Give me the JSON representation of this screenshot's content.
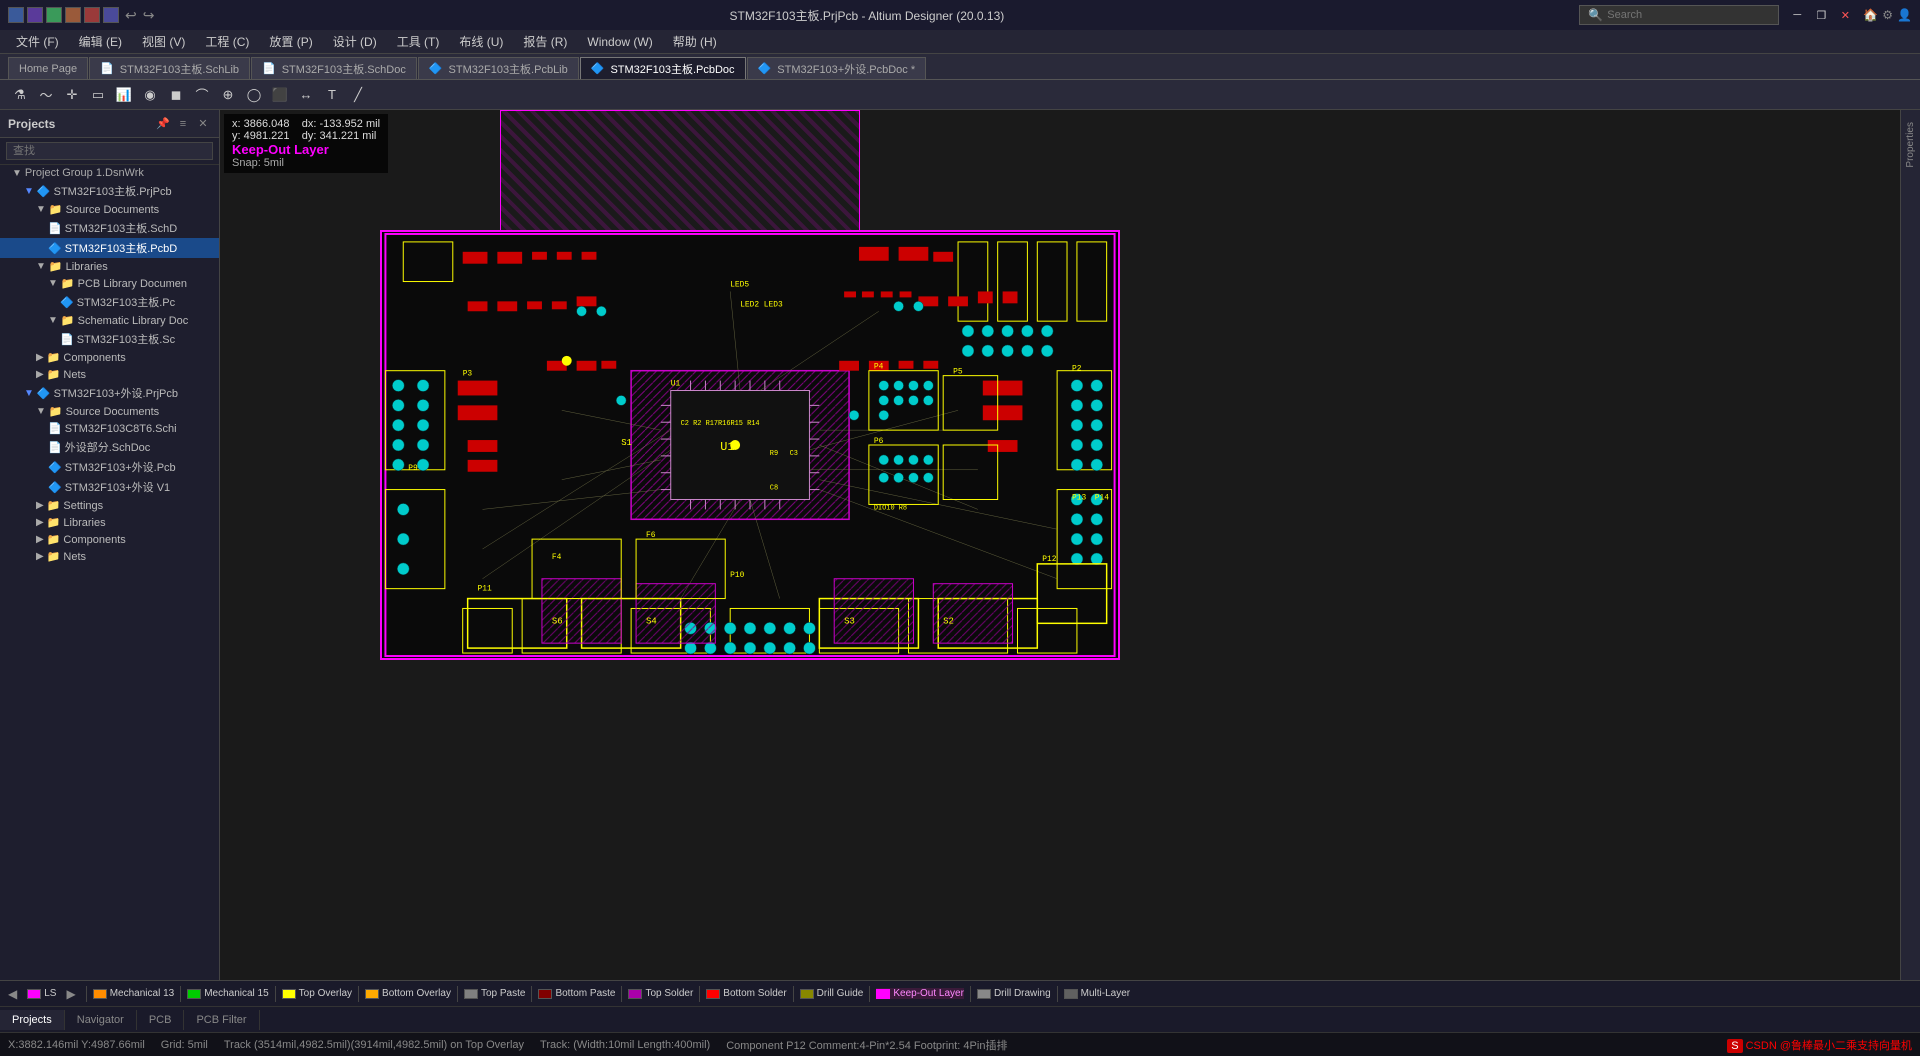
{
  "titlebar": {
    "title": "STM32F103主板.PrjPcb - Altium Designer (20.0.13)",
    "search_placeholder": "Search",
    "minimize_label": "─",
    "restore_label": "❐",
    "close_label": "✕"
  },
  "menubar": {
    "items": [
      {
        "label": "文件 (F)"
      },
      {
        "label": "编辑 (E)"
      },
      {
        "label": "视图 (V)"
      },
      {
        "label": "工程 (C)"
      },
      {
        "label": "放置 (P)"
      },
      {
        "label": "设计 (D)"
      },
      {
        "label": "工具 (T)"
      },
      {
        "label": "布线 (U)"
      },
      {
        "label": "报告 (R)"
      },
      {
        "label": "Window (W)"
      },
      {
        "label": "帮助 (H)"
      }
    ]
  },
  "tabbar": {
    "tabs": [
      {
        "label": "Home Page",
        "active": false,
        "modified": false
      },
      {
        "label": "STM32F103主板.SchLib",
        "active": false,
        "modified": false
      },
      {
        "label": "STM32F103主板.SchDoc",
        "active": false,
        "modified": false
      },
      {
        "label": "STM32F103主板.PcbLib",
        "active": false,
        "modified": false
      },
      {
        "label": "STM32F103主板.PcbDoc",
        "active": true,
        "modified": false
      },
      {
        "label": "STM32F103+外设.PcbDoc",
        "active": false,
        "modified": true
      }
    ]
  },
  "coordinates": {
    "x_label": "x:",
    "x_value": "3866.048",
    "dx_label": "dx:",
    "dx_value": "-133.952 mil",
    "y_label": "y:",
    "y_value": "4981.221",
    "dy_label": "dy:",
    "dy_value": "341.221 mil",
    "layer": "Keep-Out Layer",
    "snap": "Snap: 5mil"
  },
  "sidebar": {
    "title": "Projects",
    "search_placeholder": "查找",
    "tree": {
      "group1": {
        "label": "Project Group 1.DsnWrk",
        "children": {
          "project1": {
            "label": "STM32F103主板.PrjPcb",
            "children": {
              "source_docs": {
                "label": "Source Documents",
                "children": [
                  {
                    "label": "STM32F103主板.SchD",
                    "type": "sch"
                  },
                  {
                    "label": "STM32F103主板.PcbD",
                    "type": "pcb",
                    "selected": true
                  }
                ]
              },
              "libraries": {
                "label": "Libraries",
                "children": {
                  "pcb_lib": {
                    "label": "PCB Library Documen",
                    "children": [
                      {
                        "label": "STM32F103主板.Pc",
                        "type": "pcblib"
                      }
                    ]
                  },
                  "sch_lib": {
                    "label": "Schematic Library Doc",
                    "children": [
                      {
                        "label": "STM32F103主板.Sc",
                        "type": "schlib"
                      }
                    ]
                  }
                }
              },
              "components": {
                "label": "Components"
              },
              "nets": {
                "label": "Nets"
              }
            }
          },
          "project2": {
            "label": "STM32F103+外设.PrjPcb",
            "children": {
              "source_docs2": {
                "label": "Source Documents",
                "children": [
                  {
                    "label": "STM32F103C8T6.Schi",
                    "type": "sch"
                  },
                  {
                    "label": "外设部分.SchDoc",
                    "type": "sch"
                  },
                  {
                    "label": "STM32F103+外设.Pcb",
                    "type": "pcb"
                  },
                  {
                    "label": "STM32F103+外设 V1",
                    "type": "pcb"
                  }
                ]
              },
              "settings": {
                "label": "Settings"
              },
              "libraries2": {
                "label": "Libraries"
              },
              "components2": {
                "label": "Components"
              },
              "nets2": {
                "label": "Nets"
              }
            }
          }
        }
      }
    }
  },
  "sidebar_tabs": [
    {
      "label": "Projects",
      "active": true
    },
    {
      "label": "Navigator"
    },
    {
      "label": "PCB"
    },
    {
      "label": "PCB Filter"
    }
  ],
  "layers": [
    {
      "label": "LS",
      "color": "#ff00ff"
    },
    {
      "label": "Mechanical 13",
      "color": "#ff8c00"
    },
    {
      "label": "Mechanical 15",
      "color": "#00ff00"
    },
    {
      "label": "Top Overlay",
      "color": "#ffff00"
    },
    {
      "label": "Bottom Overlay",
      "color": "#ffaa00"
    },
    {
      "label": "Top Paste",
      "color": "#808080"
    },
    {
      "label": "Bottom Paste",
      "color": "#800000"
    },
    {
      "label": "Top Solder",
      "color": "#aa00aa"
    },
    {
      "label": "Bottom Solder",
      "color": "#ff0000"
    },
    {
      "label": "Drill Guide",
      "color": "#888800"
    },
    {
      "label": "Keep-Out Layer",
      "color": "#ff00ff"
    },
    {
      "label": "Drill Drawing",
      "color": "#888888"
    },
    {
      "label": "Multi-Layer",
      "color": "#808080"
    }
  ],
  "statusbar": {
    "coords": "X:3882.146mil Y:4987.66mil",
    "grid": "Grid: 5mil",
    "track_info": "Track (3514mil,4982.5mil)(3914mil,4982.5mil) on Top Overlay",
    "track_info2": "Track: (Width:10mil Length:400mil)",
    "component_info": "Component P12 Comment:4-Pin*2.54 Footprint: 4Pin插排",
    "watermark": "CSDN @鲁棒最小二乘支持向量机"
  },
  "right_panel": {
    "label": "Properties"
  },
  "icons": {
    "folder": "📁",
    "folder_open": "📂",
    "sch_file": "📄",
    "pcb_file": "🔷",
    "lib_file": "📚",
    "chevron_right": "▶",
    "chevron_down": "▼",
    "filter": "⚗",
    "route": "〜",
    "add": "+",
    "cursor": "✛",
    "rectangle": "▭",
    "chart": "📊",
    "target": "◎",
    "text": "T",
    "line": "╱"
  }
}
